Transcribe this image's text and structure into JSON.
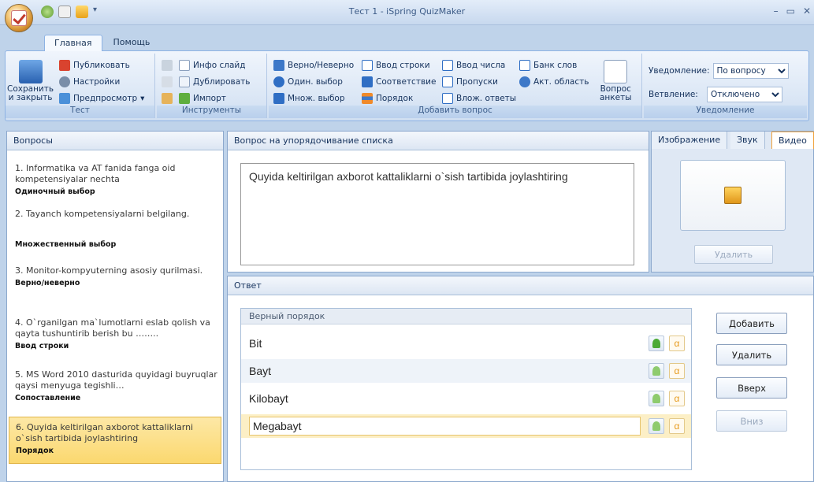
{
  "window": {
    "title": "Тест 1 - iSpring QuizMaker"
  },
  "tabs": [
    {
      "label": "Главная"
    },
    {
      "label": "Помощь"
    }
  ],
  "ribbon": {
    "test_group": {
      "save_label": "Сохранить\nи закрыть",
      "publish": "Публиковать",
      "settings": "Настройки",
      "preview": "Предпросмотр",
      "label": "Тест"
    },
    "tools_group": {
      "info_slide": "Инфо слайд",
      "duplicate": "Дублировать",
      "import": "Импорт",
      "label": "Инструменты"
    },
    "add_group": {
      "true_false": "Верно/Неверно",
      "single_choice": "Один. выбор",
      "multi_choice": "Множ. выбор",
      "short_answer": "Ввод строки",
      "matching": "Соответствие",
      "sequence": "Порядок",
      "numeric": "Ввод числа",
      "fill_blanks": "Пропуски",
      "dropdowns": "Влож. ответы",
      "word_bank": "Банк слов",
      "hotspot": "Акт. область",
      "survey": "Вопрос\nанкеты",
      "label": "Добавить вопрос"
    },
    "notif_group": {
      "notify_label": "Уведомление:",
      "notify_value": "По вопросу",
      "branch_label": "Ветвление:",
      "branch_value": "Отключено",
      "label": "Уведомление"
    }
  },
  "questions_panel": {
    "title": "Вопросы",
    "items": [
      {
        "text": "1. Informatika va AT fanida fanga oid kompetensiyalar nechta",
        "type": "Одиночный выбор"
      },
      {
        "text": "2. Tayanch kompetensiyalarni belgilang.",
        "type": "Множественный выбор"
      },
      {
        "text": "3. Monitor-kompyuterning asosiy qurilmasi.",
        "type": "Верно/неверно"
      },
      {
        "text": "4. O`rganilgan ma`lumotlarni eslab qolish va qayta tushuntirib berish bu ……..",
        "type": "Ввод строки"
      },
      {
        "text": "5. MS Word 2010 dasturida quyidagi buyruqlar qaysi menyuga tegishli…",
        "type": "Сопоставление"
      },
      {
        "text": "6. Quyida keltirilgan axborot kattaliklarni o`sish tartibida joylashtiring",
        "type": "Порядок"
      }
    ]
  },
  "question": {
    "header": "Вопрос на упорядочивание списка",
    "text": "Quyida keltirilgan axborot kattaliklarni o`sish tartibida joylashtiring"
  },
  "media": {
    "tabs": [
      "Изображение",
      "Звук",
      "Видео"
    ],
    "delete": "Удалить"
  },
  "answer": {
    "header": "Ответ",
    "list_header": "Верный порядок",
    "items": [
      "Bit",
      "Bayt",
      "Kilobayt",
      "Megabayt"
    ],
    "buttons": {
      "add": "Добавить",
      "delete": "Удалить",
      "up": "Вверх",
      "down": "Вниз"
    }
  }
}
